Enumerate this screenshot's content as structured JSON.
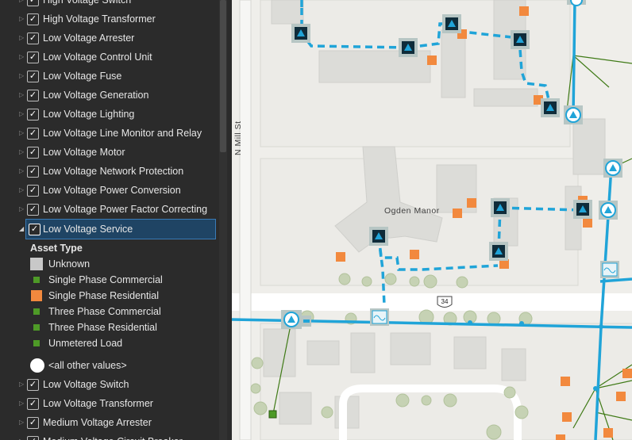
{
  "layers_top": [
    {
      "label": "High Voltage Switch"
    },
    {
      "label": "High Voltage Transformer"
    },
    {
      "label": "Low Voltage Arrester"
    },
    {
      "label": "Low Voltage Control Unit"
    },
    {
      "label": "Low Voltage Fuse"
    },
    {
      "label": "Low Voltage Generation"
    },
    {
      "label": "Low Voltage Lighting"
    },
    {
      "label": "Low Voltage Line Monitor and Relay"
    },
    {
      "label": "Low Voltage Motor"
    },
    {
      "label": "Low Voltage Network Protection"
    },
    {
      "label": "Low Voltage Power Conversion"
    },
    {
      "label": "Low Voltage Power Factor Correcting"
    }
  ],
  "selected_layer": {
    "label": "Low Voltage Service",
    "checked": true,
    "expanded": true
  },
  "legend": {
    "field_label": "Asset Type",
    "items": [
      {
        "label": "Unknown",
        "color": "#c8c8c8",
        "shape": "square-large"
      },
      {
        "label": "Single Phase Commercial",
        "color": "#4e9a27",
        "shape": "square-small"
      },
      {
        "label": "Single Phase Residential",
        "color": "#f2893e",
        "shape": "square-medium"
      },
      {
        "label": "Three Phase Commercial",
        "color": "#4e9a27",
        "shape": "square-small"
      },
      {
        "label": "Three Phase Residential",
        "color": "#4e9a27",
        "shape": "square-small"
      },
      {
        "label": "Unmetered Load",
        "color": "#4e9a27",
        "shape": "square-small"
      },
      {
        "label": "<all other values>",
        "color": "#ffffff",
        "shape": "circle"
      }
    ]
  },
  "layers_bottom": [
    {
      "label": "Low Voltage Switch"
    },
    {
      "label": "Low Voltage Transformer"
    },
    {
      "label": "Medium Voltage Arrester"
    },
    {
      "label": "Medium Voltage Circuit Breaker"
    }
  ],
  "map": {
    "street_label": "N Mill St",
    "place_label": "Ogden Manor",
    "route_shield": "34",
    "colors": {
      "line": "#20a4d8",
      "transformer_fill": "#0f2c3a",
      "service": "#f2893e",
      "lv_line": "#3f7a16"
    }
  }
}
